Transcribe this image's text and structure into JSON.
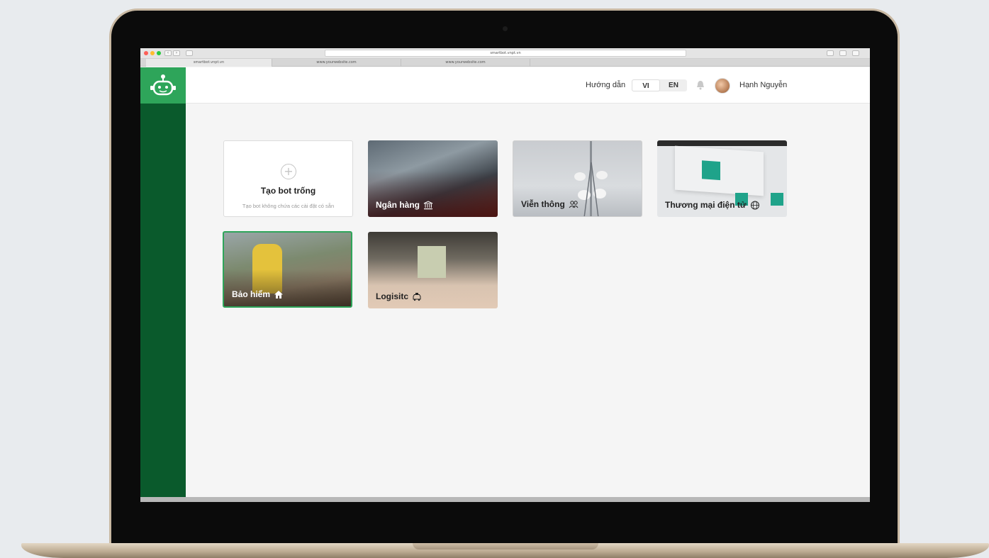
{
  "browser": {
    "address": "smartbot.vnpt.vn",
    "tabs": [
      "smartbot.vnpt.vn",
      "www.yourwebsite.com",
      "www.yourwebsite.com"
    ]
  },
  "header": {
    "guide": "Hướng dẫn",
    "lang_vi": "VI",
    "lang_en": "EN",
    "user_name": "Hạnh Nguyễn"
  },
  "cards": {
    "blank_title": "Tạo bot trống",
    "blank_sub": "Tạo bot không chứa các cài đặt có sẵn",
    "bank": "Ngân hàng",
    "telecom": "Viễn thông",
    "ecommerce": "Thương mại điện tử",
    "insurance": "Bảo hiểm",
    "logistics": "Logisitc"
  },
  "colors": {
    "brand_green": "#2ea55a",
    "sidebar_green": "#0a5a2c"
  },
  "icons": {
    "logo": "robot-icon",
    "bank": "bank-icon",
    "telecom": "people-icon",
    "ecommerce": "globe-icon",
    "insurance": "house-icon",
    "logistics": "taxi-icon",
    "bell": "bell-icon"
  }
}
